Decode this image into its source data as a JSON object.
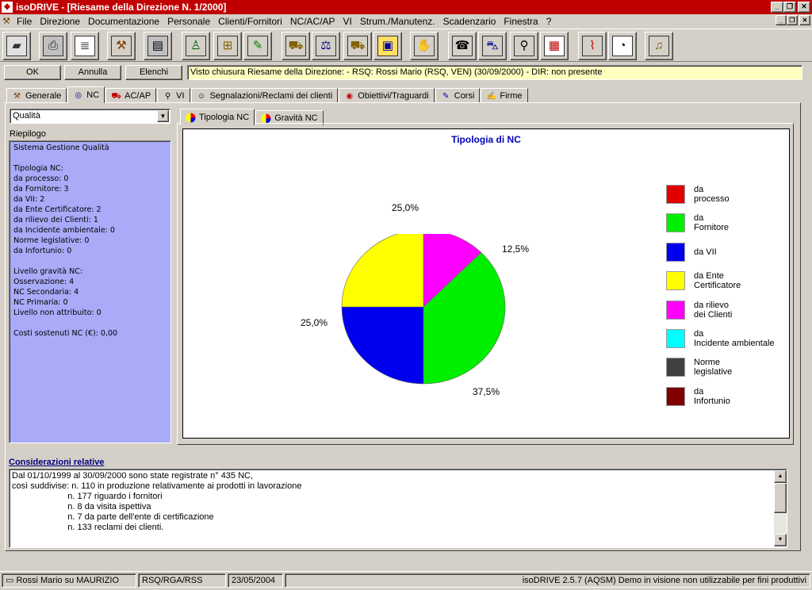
{
  "window": {
    "title": "isoDRIVE - [Riesame della Direzione N. 1/2000]",
    "min_btn": "_",
    "max_btn": "❐",
    "close_btn": "✕"
  },
  "menu": [
    "File",
    "Direzione",
    "Documentazione",
    "Personale",
    "Clienti/Fornitori",
    "NC/AC/AP",
    "VI",
    "Strum./Manutenz.",
    "Scadenzario",
    "Finestra",
    "?"
  ],
  "toolbar_icons": [
    "disk-icon",
    "printer-icon",
    "document-icon",
    "gavel-icon",
    "book-icon",
    "person-icon",
    "org-chart-icon",
    "presenter-icon",
    "hand-truck-icon",
    "scales-icon",
    "cart-icon",
    "box-icon",
    "handshake-icon",
    "phone-icon",
    "car-icon",
    "magnifier-icon",
    "calendar-icon",
    "thermometer-icon",
    "stopwatch-icon",
    "bell-icon"
  ],
  "buttons": {
    "ok": "OK",
    "annulla": "Annulla",
    "elenchi": "Elenchi"
  },
  "status_message": "Visto chiusura Riesame della Direzione: - RSQ: Rossi Mario (RSQ, VEN) (30/09/2000) - DIR: non presente",
  "main_tabs": [
    {
      "label": "Generale",
      "icon": "gavel-icon"
    },
    {
      "label": "NC",
      "icon": "nc-icon"
    },
    {
      "label": "AC/AP",
      "icon": "truck-icon"
    },
    {
      "label": "VI",
      "icon": "magnifier-icon"
    },
    {
      "label": "Segnalazioni/Reclami dei clienti",
      "icon": "people-icon"
    },
    {
      "label": "Obiettivi/Traguardi",
      "icon": "target-icon"
    },
    {
      "label": "Corsi",
      "icon": "course-icon"
    },
    {
      "label": "Firme",
      "icon": "signature-icon"
    }
  ],
  "combo": {
    "value": "Qualità"
  },
  "riepilogo": {
    "label": "Riepilogo",
    "text": "Sistema Gestione Qualità\n\nTipologia NC:\nda processo: 0\nda Fornitore: 3\nda VII: 2\nda Ente Certificatore: 2\nda rilievo dei Clienti: 1\nda Incidente ambientale: 0\nNorme legislative: 0\nda Infortunio: 0\n\nLivello gravità NC:\nOsservazione: 4\nNC Secondaria: 4\nNC Primaria: 0\nLivello non attribuito: 0\n\nCosti sostenuti NC (€): 0,00"
  },
  "chart_tabs": [
    {
      "label": "Tipologia NC",
      "icon": "pie-chart-icon"
    },
    {
      "label": "Gravità NC",
      "icon": "pie-chart-icon"
    }
  ],
  "chart_data": {
    "type": "pie",
    "title": "Tipologia di NC",
    "categories": [
      "da processo",
      "da Fornitore",
      "da VII",
      "da Ente Certificatore",
      "da rilievo dei Clienti",
      "da Incidente ambientale",
      "Norme legislative",
      "da Infortunio"
    ],
    "values": [
      0,
      3,
      2,
      2,
      1,
      0,
      0,
      0
    ],
    "colors": [
      "#e00000",
      "#00ee00",
      "#0000ee",
      "#ffff00",
      "#ff00ff",
      "#00ffff",
      "#404040",
      "#800000"
    ],
    "slice_labels": [
      "37,5%",
      "25,0%",
      "25,0%",
      "12,5%"
    ],
    "legend": [
      {
        "line1": "da",
        "line2": "processo"
      },
      {
        "line1": "da",
        "line2": "Fornitore"
      },
      {
        "line1": "da VII",
        "line2": ""
      },
      {
        "line1": "da Ente",
        "line2": "Certificatore"
      },
      {
        "line1": "da rilievo",
        "line2": "dei Clienti"
      },
      {
        "line1": "da",
        "line2": "Incidente ambientale"
      },
      {
        "line1": "Norme",
        "line2": "legislative"
      },
      {
        "line1": "da",
        "line2": "Infortunio"
      }
    ],
    "legend_position": "right"
  },
  "considerazioni": {
    "label": "Considerazioni relative",
    "text": "Dal 01/10/1999 al 30/09/2000 sono state registrate n° 435 NC,\ncosì suddivise: n. 110 in produzione relativamente ai prodotti in lavorazione\n                       n. 177 riguardo i fornitori\n                       n. 8 da visita ispettiva\n                       n. 7 da parte dell'ente di certificazione\n                       n. 133 reclami dei clienti."
  },
  "statusbar": {
    "user": "Rossi Mario su MAURIZIO",
    "roles": "RSQ/RGA/RSS",
    "date": "23/05/2004",
    "version": "isoDRIVE 2.5.7 (AQSM) Demo in visione non utilizzabile per fini produttivi"
  }
}
